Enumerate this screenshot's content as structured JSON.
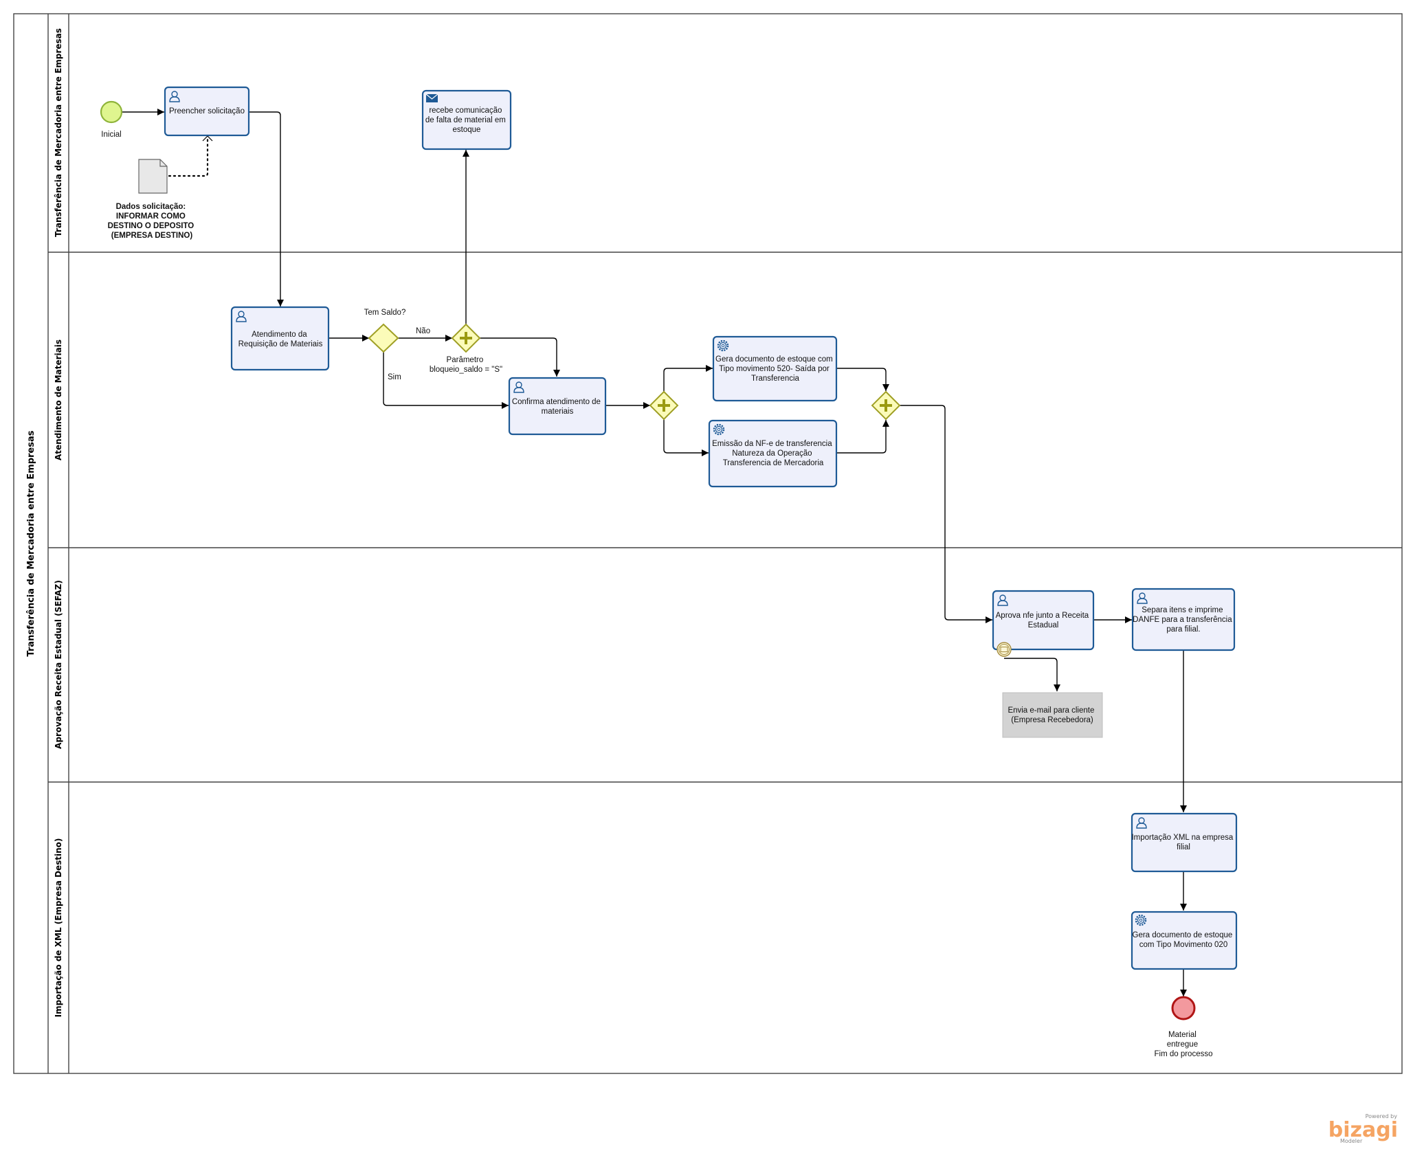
{
  "pool": {
    "title": "Transferência de Mercadoria entre Empresas"
  },
  "lanes": [
    {
      "title": "Transferência de Mercadoria entre Empresas"
    },
    {
      "title": "Atendimento de Materiais"
    },
    {
      "title": "Aprovação Receita Estadual (SEFAZ)"
    },
    {
      "title": "Importação de XML (Empresa Destino)"
    }
  ],
  "events": {
    "start": {
      "label": "Inicial",
      "color": "#dff58f"
    },
    "end": {
      "lines": [
        "Material",
        "entregue",
        "Fim do processo"
      ],
      "color": "#f3999e"
    }
  },
  "data_object": {
    "lines": [
      "Dados solicitação:",
      "INFORMAR COMO",
      "DESTINO O DEPOSITO",
      "(EMPRESA DESTINO)"
    ]
  },
  "tasks": {
    "preencher": {
      "type": "user",
      "lines": [
        "Preencher solicitação"
      ]
    },
    "recebe": {
      "type": "message",
      "lines": [
        "recebe comunicação",
        "de falta de material em",
        "estoque"
      ]
    },
    "atendimento": {
      "type": "user",
      "lines": [
        "Atendimento da",
        "Requisição de Materiais"
      ]
    },
    "confirma": {
      "type": "user",
      "lines": [
        "Confirma atendimento de",
        "materiais"
      ]
    },
    "gera520": {
      "type": "service",
      "lines": [
        "Gera documento de estoque com",
        "Tipo movimento 520- Saída por",
        "Transferencia"
      ]
    },
    "emissao": {
      "type": "service",
      "lines": [
        "Emissão da NF-e de transferencia",
        "Natureza da Operação",
        "Transferencia de Mercadoria"
      ]
    },
    "aprova": {
      "type": "user",
      "lines": [
        "Aprova nfe junto a Receita",
        "Estadual"
      ]
    },
    "separa": {
      "type": "user",
      "lines": [
        "Separa itens e imprime",
        "DANFE para a transferência",
        "para filial."
      ]
    },
    "envia": {
      "type": "grey",
      "lines": [
        "Envia e-mail para cliente",
        "(Empresa Recebedora)"
      ]
    },
    "importacao": {
      "type": "user",
      "lines": [
        "Importação XML na empresa",
        "filial"
      ]
    },
    "gera020": {
      "type": "service",
      "lines": [
        "Gera documento de estoque",
        "com Tipo Movimento 020"
      ]
    }
  },
  "gateways": {
    "tem_saldo": {
      "label": "Tem Saldo?"
    },
    "param": {
      "lines": [
        "Parâmetro",
        "bloqueio_saldo = \"S\""
      ]
    }
  },
  "flow_labels": {
    "nao": "Não",
    "sim": "Sim"
  },
  "branding": {
    "powered": "Powered by",
    "logo": "bizagi",
    "product": "Modeler"
  },
  "colors": {
    "task_fill": "#eef0fb",
    "task_stroke": "#1e5a96",
    "gateway_fill": "#fbfbb9",
    "gateway_stroke": "#9f9f24",
    "gateway_cross": "#9a9a10",
    "brand": "#f5a463"
  }
}
